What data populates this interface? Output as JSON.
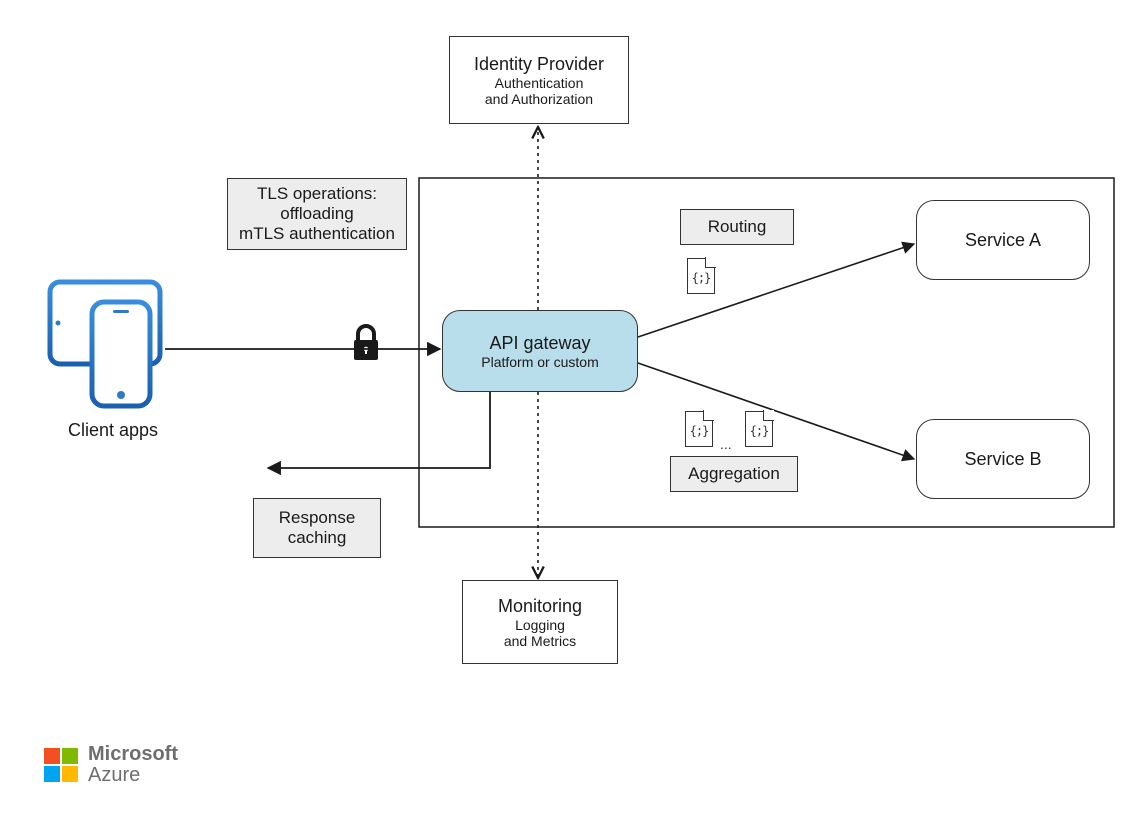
{
  "identity_provider": {
    "title": "Identity Provider",
    "line1": "Authentication",
    "line2": "and Authorization"
  },
  "tls_box": {
    "line1": "TLS operations:",
    "line2": "offloading",
    "line3": "mTLS authentication"
  },
  "client_caption": "Client apps",
  "gateway": {
    "title": "API gateway",
    "subtitle": "Platform or custom"
  },
  "routing_label": "Routing",
  "aggregation_label": "Aggregation",
  "aggregation_dots": "...",
  "service_a": "Service A",
  "service_b": "Service B",
  "response_caching": {
    "line1": "Response",
    "line2": "caching"
  },
  "monitoring": {
    "title": "Monitoring",
    "line1": "Logging",
    "line2": "and Metrics"
  },
  "azure": {
    "brand1": "Microsoft",
    "brand2": "Azure"
  }
}
